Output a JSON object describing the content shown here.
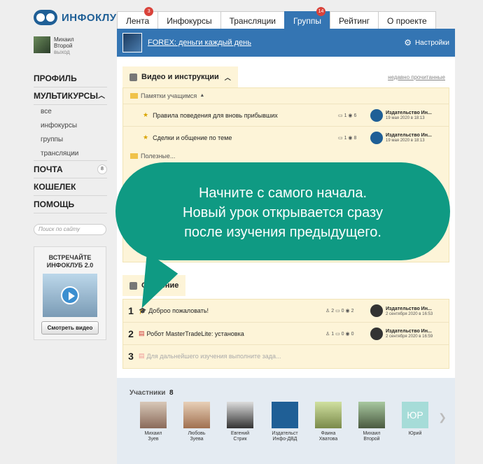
{
  "brand": "ИНФОКЛУБ",
  "user": {
    "first": "Михаил",
    "last": "Второй",
    "logout": "выход"
  },
  "nav": [
    {
      "label": "ПРОФИЛЬ"
    },
    {
      "label": "МУЛЬТИКУРСЫ",
      "expanded": "^"
    },
    {
      "sub": "все"
    },
    {
      "sub": "инфокурсы"
    },
    {
      "sub": "группы"
    },
    {
      "sub": "трансляции"
    },
    {
      "label": "ПОЧТА",
      "badge": "8"
    },
    {
      "label": "КОШЕЛЕК"
    },
    {
      "label": "ПОМОЩЬ"
    }
  ],
  "search_placeholder": "Поиск по сайту",
  "promo": {
    "title_1": "ВСТРЕЧАЙТЕ",
    "title_2": "ИНФОКЛУБ 2.0",
    "button": "Смотреть видео"
  },
  "tabs": [
    {
      "label": "Лента",
      "count": "3"
    },
    {
      "label": "Инфокурсы"
    },
    {
      "label": "Трансляции"
    },
    {
      "label": "Группы",
      "count": "14",
      "active": true
    },
    {
      "label": "Рейтинг"
    },
    {
      "label": "О проекте"
    }
  ],
  "group": {
    "name": "FOREX: деньги каждый день",
    "settings": "Настройки"
  },
  "section1": {
    "title": "Видео и инструкции",
    "unread_link": "недавно прочитанные",
    "folder1": "Памятки учащимся",
    "folder2": "Полезные...",
    "rows": [
      {
        "title": "Правила поведения для вновь прибывших",
        "comments": "1",
        "views": "6",
        "author": "Издательство Ин...",
        "date": "19 мая 2020 в 18:13"
      },
      {
        "title": "Сделки и общение по теме",
        "comments": "1",
        "views": "8",
        "author": "Издательство Ин...",
        "date": "19 мая 2020 в 18:13"
      }
    ]
  },
  "section2": {
    "title": "Обучение",
    "rows": [
      {
        "num": "1",
        "title": "Доброо пожаловать!",
        "a": "2",
        "comments": "0",
        "views": "2",
        "author": "Издательство Ин...",
        "date": "2 сентября 2020 в 16:53"
      },
      {
        "num": "2",
        "title": "Робот MasterTradeLite: установка",
        "a": "1",
        "comments": "0",
        "views": "0",
        "author": "Издательство Ин...",
        "date": "2 сентября 2020 в 16:59"
      },
      {
        "num": "3",
        "title": "Для дальнейшего изучения выполните зада..."
      }
    ]
  },
  "bubble": {
    "line1": "Начните с самого начала.",
    "line2": "Новый урок открывается сразу",
    "line3": "после изучения предыдущего."
  },
  "members": {
    "title": "Участники",
    "count": "8",
    "list": [
      {
        "first": "Михаил",
        "last": "Зуев"
      },
      {
        "first": "Любовь",
        "last": "Зуева"
      },
      {
        "first": "Евгений",
        "last": "Стрик"
      },
      {
        "first": "Издательст",
        "last": "Инфо-ДВД"
      },
      {
        "first": "Фаина",
        "last": "Хватова"
      },
      {
        "first": "Михаил",
        "last": "Второй"
      },
      {
        "first": "Юрий",
        "last": ""
      }
    ],
    "yr_text": "ЮР"
  }
}
